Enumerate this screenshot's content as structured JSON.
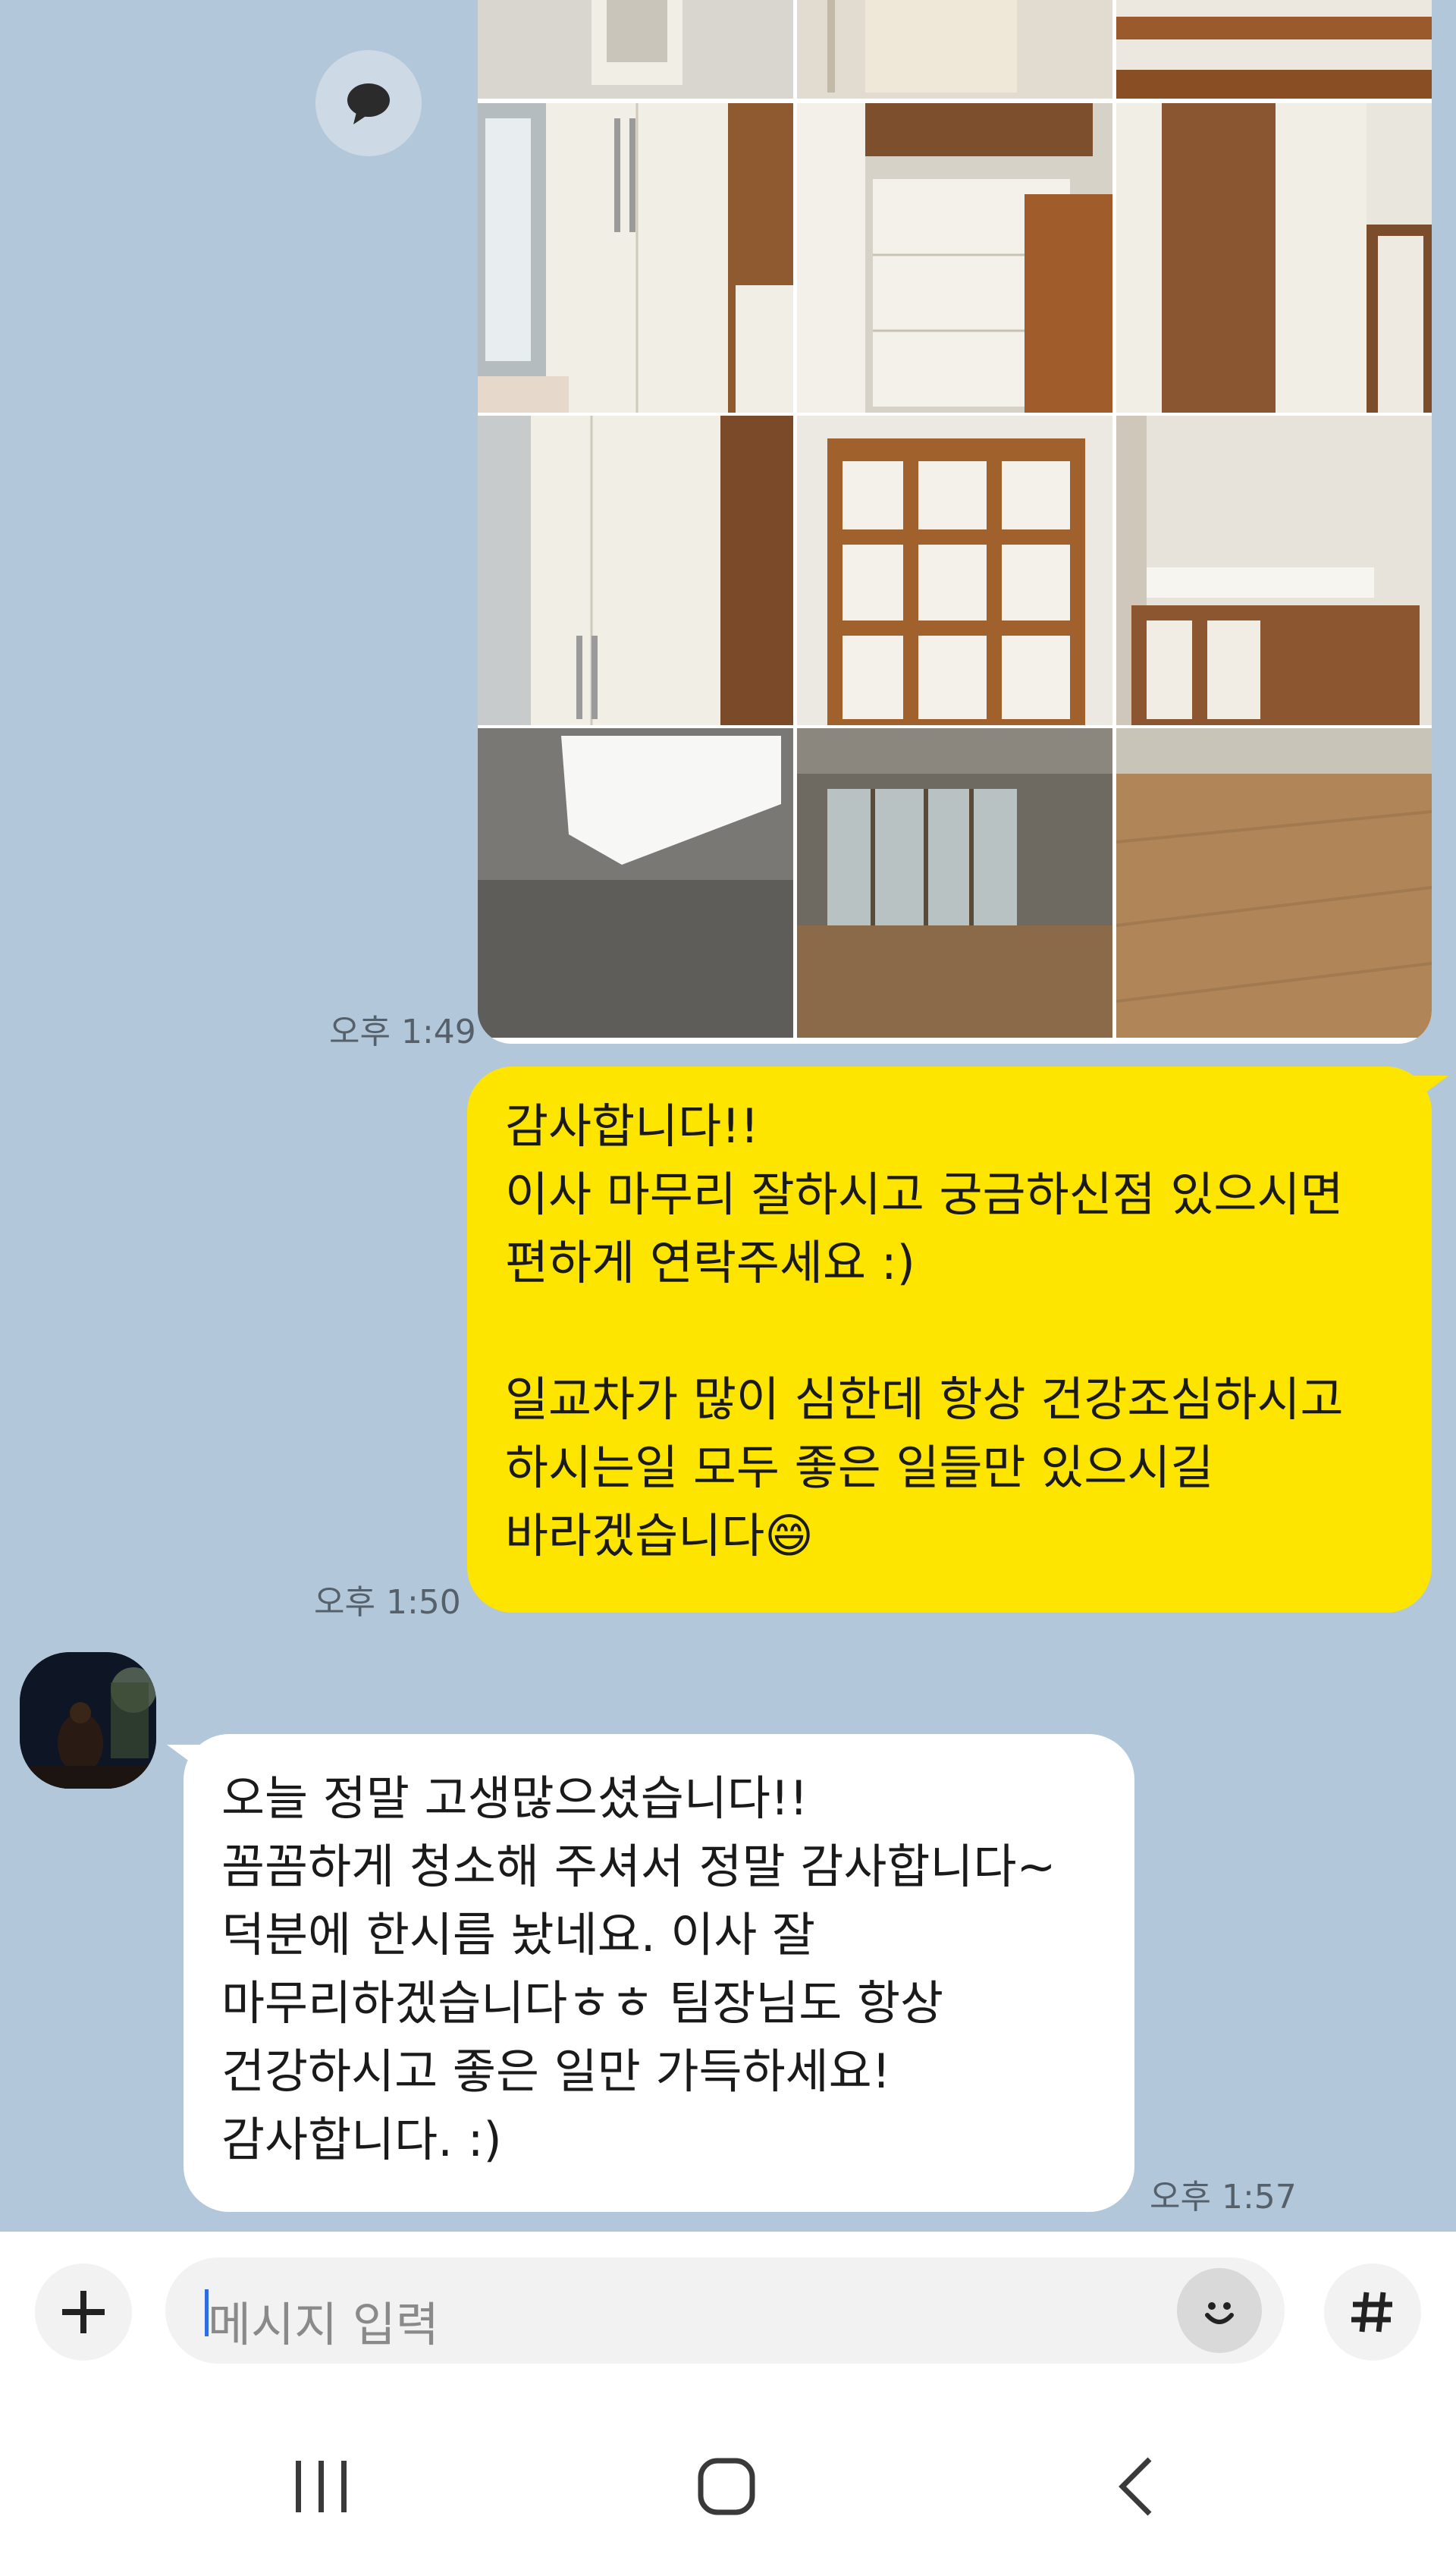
{
  "photo_message": {
    "time": "오후 1:49",
    "photos": [
      "wall-shelf",
      "balcony-door-cabinet",
      "open-shelf-cabinet",
      "white-wardrobe",
      "white-drawers",
      "white-cabinet-door",
      "tall-wardrobe",
      "wooden-bookshelf",
      "low-shelf",
      "ceiling-light",
      "living-room-window",
      "wood-floor"
    ]
  },
  "my_message": {
    "time": "오후 1:50",
    "text": "감사합니다!!\n이사 마무리 잘하시고 궁금하신점 있으시면\n편하게 연락주세요 :)\n\n일교차가 많이 심한데 항상 건강조심하시고\n하시는일 모두 좋은 일들만 있으시길\n바라겠습니다😄"
  },
  "other_message": {
    "time": "오후 1:57",
    "text": "오늘 정말 고생많으셨습니다!!\n꼼꼼하게 청소해 주셔서 정말 감사합니다~\n덕분에 한시름 놨네요. 이사 잘\n마무리하겠습니다ㅎㅎ 팀장님도 항상\n건강하시고 좋은 일만 가득하세요!\n감사합니다. :)"
  },
  "input": {
    "placeholder": "메시지 입력"
  },
  "icons": {
    "share": "speech-bubble-icon",
    "plus": "plus-icon",
    "emoji": "emoji-icon",
    "hash": "hash-icon",
    "recent": "recent-apps-icon",
    "home": "home-icon",
    "back": "back-icon"
  },
  "colors": {
    "chat_background": "#b2c7d9",
    "my_bubble": "#fee500",
    "other_bubble": "#ffffff"
  }
}
